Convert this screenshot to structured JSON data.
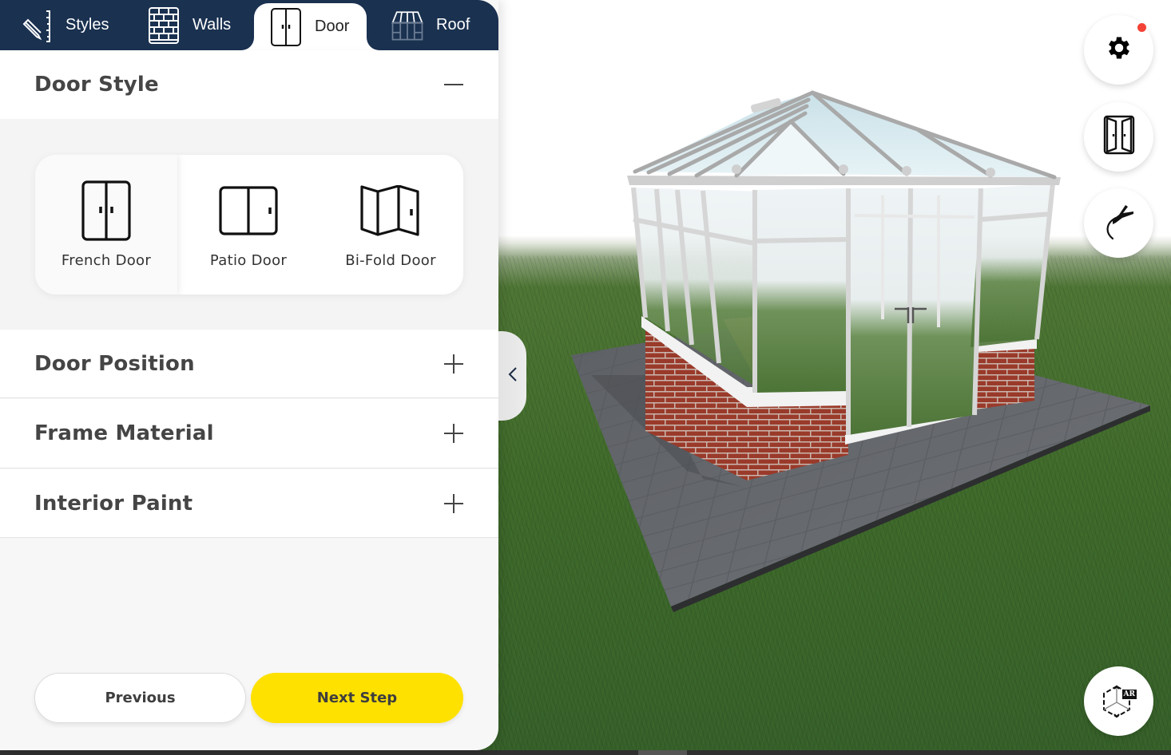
{
  "tabs": [
    {
      "label": "Styles",
      "icon": "ruler-pencil-icon",
      "active": false
    },
    {
      "label": "Walls",
      "icon": "brick-wall-icon",
      "active": false
    },
    {
      "label": "Door",
      "icon": "french-door-icon",
      "active": true
    },
    {
      "label": "Roof",
      "icon": "conservatory-roof-icon",
      "active": false
    }
  ],
  "accordion": {
    "door_style": {
      "title": "Door Style",
      "expanded": true,
      "options": [
        {
          "label": "French Door",
          "icon": "french-door-icon",
          "selected": true
        },
        {
          "label": "Patio Door",
          "icon": "patio-door-icon",
          "selected": false
        },
        {
          "label": "Bi-Fold Door",
          "icon": "bifold-door-icon",
          "selected": false
        }
      ]
    },
    "door_position": {
      "title": "Door Position",
      "expanded": false
    },
    "frame_material": {
      "title": "Frame Material",
      "expanded": false
    },
    "interior_paint": {
      "title": "Interior Paint",
      "expanded": false
    }
  },
  "footer": {
    "previous_label": "Previous",
    "next_label": "Next Step"
  },
  "side_actions": [
    {
      "name": "settings",
      "icon": "gear-icon",
      "notification": true
    },
    {
      "name": "open-doors",
      "icon": "open-door-icon"
    },
    {
      "name": "fly-through",
      "icon": "airplane-icon"
    },
    {
      "name": "ar-view",
      "icon": "ar-cube-icon",
      "badge": "AR"
    }
  ],
  "colors": {
    "tabbar": "#1a3150",
    "accent": "#ffe100",
    "notification": "#f44336",
    "heading_text": "#454545"
  }
}
